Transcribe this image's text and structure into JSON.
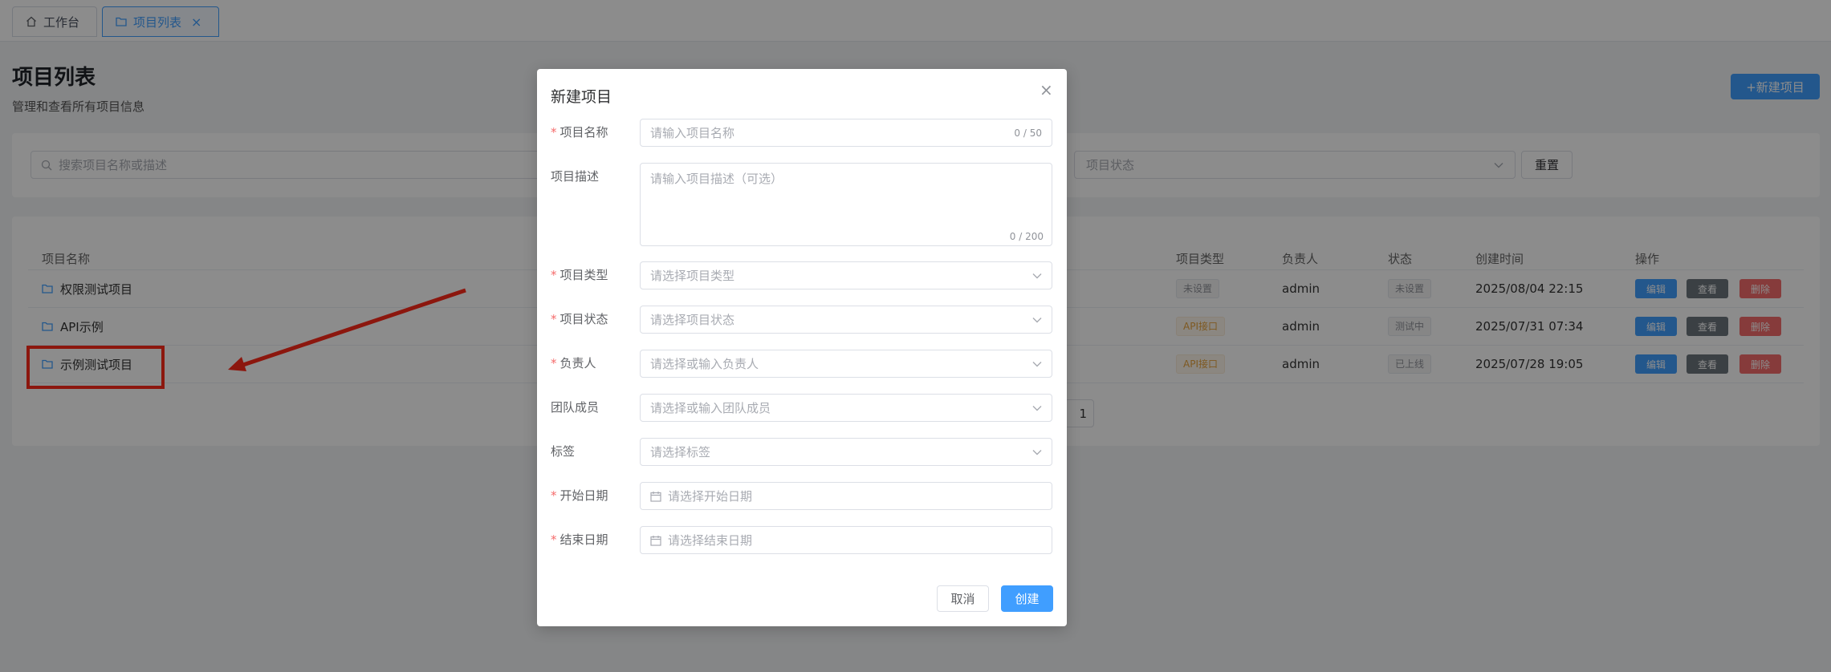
{
  "tabs": [
    {
      "label": "工作台",
      "icon": "home-icon"
    },
    {
      "label": "项目列表",
      "icon": "folder-icon",
      "close": "×"
    }
  ],
  "header": {
    "title": "项目列表",
    "subtitle": "管理和查看所有项目信息",
    "new_button": "+新建项目"
  },
  "filter": {
    "search_placeholder": "搜索项目名称或描述",
    "status_placeholder": "项目状态",
    "reset_label": "重置"
  },
  "table": {
    "columns": {
      "name": "项目名称",
      "type": "项目类型",
      "owner": "负责人",
      "status": "状态",
      "created": "创建时间",
      "actions": "操作"
    },
    "rows": [
      {
        "name": "权限测试项目",
        "type": "未设置",
        "owner": "admin",
        "status": "未设置",
        "created": "2025/08/04 22:15"
      },
      {
        "name": "API示例",
        "type": "API接口",
        "owner": "admin",
        "status": "测试中",
        "created": "2025/07/31 07:34"
      },
      {
        "name": "示例测试项目",
        "type": "API接口",
        "owner": "admin",
        "status": "已上线",
        "created": "2025/07/28 19:05"
      }
    ],
    "actions": {
      "edit": "编辑",
      "view": "查看",
      "delete": "删除"
    },
    "pager_page": "1"
  },
  "annotation": {
    "color": "#ff2a1a"
  },
  "modal": {
    "title": "新建项目",
    "close": "×",
    "fields": {
      "name": {
        "label": "项目名称",
        "required": "*",
        "placeholder": "请输入项目名称",
        "count": "0 / 50"
      },
      "description": {
        "label": "项目描述",
        "placeholder": "请输入项目描述（可选）",
        "count": "0 / 200"
      },
      "type": {
        "label": "项目类型",
        "required": "*",
        "placeholder": "请选择项目类型"
      },
      "status": {
        "label": "项目状态",
        "required": "*",
        "placeholder": "请选择项目状态"
      },
      "owner": {
        "label": "负责人",
        "required": "*",
        "placeholder": "请选择或输入负责人"
      },
      "members": {
        "label": "团队成员",
        "placeholder": "请选择或输入团队成员"
      },
      "tags": {
        "label": "标签",
        "placeholder": "请选择标签"
      },
      "start_date": {
        "label": "开始日期",
        "required": "*",
        "placeholder": "请选择开始日期"
      },
      "end_date": {
        "label": "结束日期",
        "required": "*",
        "placeholder": "请选择结束日期"
      }
    },
    "cancel_label": "取消",
    "create_label": "创建"
  },
  "colors": {
    "primary": "#409eff",
    "danger": "#f56c6c",
    "secondary": "#6c757d",
    "warning": "#e6a23c"
  }
}
